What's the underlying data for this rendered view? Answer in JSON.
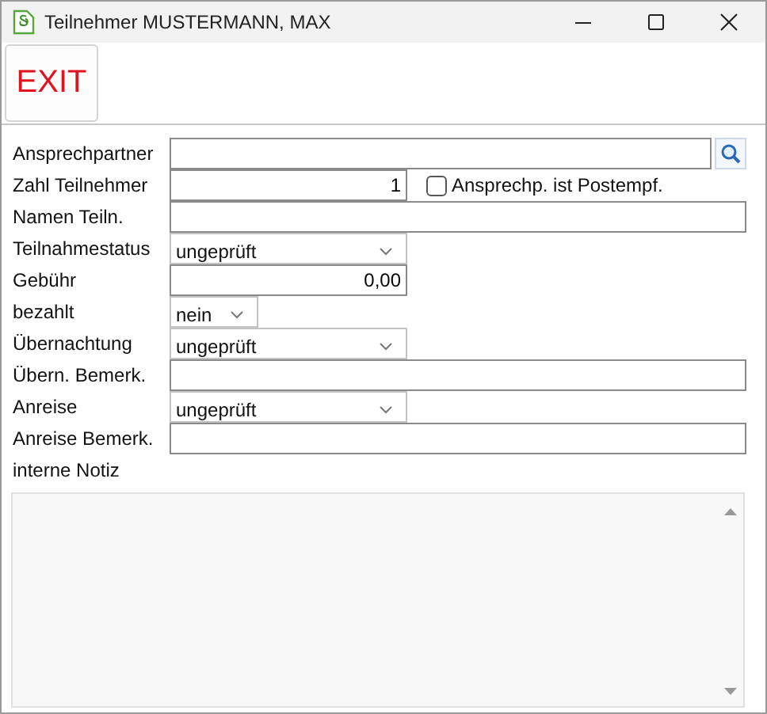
{
  "window": {
    "title": "Teilnehmer MUSTERMANN, MAX"
  },
  "toolbar": {
    "exit_button": "EXIT"
  },
  "fields": [
    {
      "label": "Ansprechpartner",
      "kind": "lookup"
    },
    {
      "label": "Zahl Teilnehmer",
      "kind": "number",
      "value": "1",
      "checkbox": {
        "label": "Ansprechp. ist Postempf.",
        "checked": false
      }
    },
    {
      "label": "Namen Teiln.",
      "kind": "text"
    },
    {
      "label": "Teilnahmestatus",
      "kind": "select",
      "value": "ungeprüft"
    },
    {
      "label": "Gebühr",
      "kind": "number",
      "value": "0,00"
    },
    {
      "label": "bezahlt",
      "kind": "small_select",
      "value": "nein"
    },
    {
      "label": "Übernachtung",
      "kind": "select",
      "value": "ungeprüft"
    },
    {
      "label": "Übern. Bemerk.",
      "kind": "text"
    },
    {
      "label": "Anreise",
      "kind": "select",
      "value": "ungeprüft"
    },
    {
      "label": "Anreise Bemerk.",
      "kind": "text"
    }
  ],
  "notes": {
    "label": "interne Notiz"
  }
}
